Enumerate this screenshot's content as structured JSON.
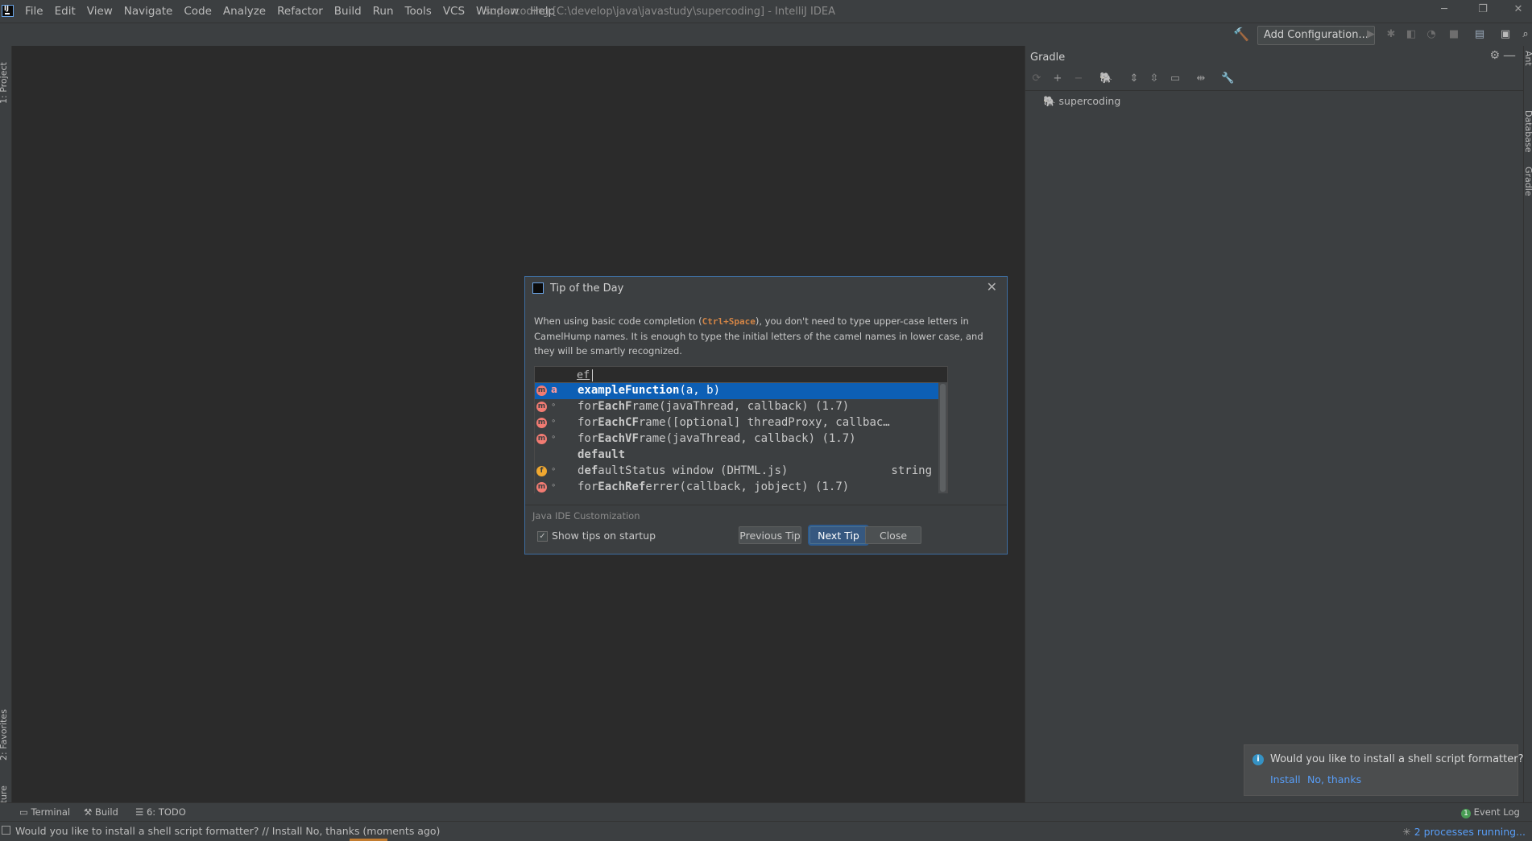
{
  "window": {
    "title": "supercoding [C:\\develop\\java\\javastudy\\supercoding] - IntelliJ IDEA",
    "minimize": "─",
    "restore": "❐",
    "close": "✕"
  },
  "menu": [
    "File",
    "Edit",
    "View",
    "Navigate",
    "Code",
    "Analyze",
    "Refactor",
    "Build",
    "Run",
    "Tools",
    "VCS",
    "Window",
    "Help"
  ],
  "toolbar": {
    "add_configuration": "Add Configuration...",
    "icons": [
      "hammer-icon",
      "run-icon",
      "debug-icon",
      "coverage-icon",
      "profile-icon",
      "stop-icon",
      "project-structure-icon",
      "sdk-icon",
      "search-icon"
    ]
  },
  "left_stripe": {
    "project": "1: Project",
    "favorites": "2: Favorites",
    "structure": "Z: Structure"
  },
  "right_stripe": {
    "ant": "Ant",
    "database": "Database",
    "gradle": "Gradle"
  },
  "gradle": {
    "title": "Gradle",
    "project": "supercoding",
    "tool_icons": [
      "refresh-icon",
      "add-icon",
      "remove-icon",
      "elephant-icon",
      "expand-all-icon",
      "collapse-all-icon",
      "link-icon",
      "offline-icon",
      "wrench-icon"
    ]
  },
  "dialog": {
    "title": "Tip of the Day",
    "tip_part1": "When using basic code completion (",
    "tip_kbd": "Ctrl+Space",
    "tip_part2": "), you don't need to type upper-case letters in CamelHump names. It is enough to type the initial letters of the camel names in lower case, and they will be smartly recognized.",
    "code_input": "ef",
    "completion": [
      {
        "icon": "m",
        "vis": "a",
        "pre": "",
        "hl": "exampleFunction",
        "post": "(a, b)",
        "tail": ""
      },
      {
        "icon": "m",
        "vis": "∘",
        "pre": "for",
        "hl": "EachF",
        "post": "rame(javaThread, callback) (1.7)",
        "tail": ""
      },
      {
        "icon": "m",
        "vis": "∘",
        "pre": "for",
        "hl": "EachCF",
        "post": "rame([optional] threadProxy, callbac…",
        "tail": ""
      },
      {
        "icon": "m",
        "vis": "∘",
        "pre": "for",
        "hl": "EachVF",
        "post": "rame(javaThread, callback) (1.7)",
        "tail": ""
      },
      {
        "icon": "",
        "vis": "",
        "pre": "",
        "hl": "default",
        "post": "",
        "tail": ""
      },
      {
        "icon": "f",
        "vis": "∘",
        "pre": "d",
        "hl": "ef",
        "post": "aultStatus window (DHTML.js)",
        "tail": "string"
      },
      {
        "icon": "m",
        "vis": "∘",
        "pre": "for",
        "hl": "EachRef",
        "post": "errer(callback, jobject) (1.7)",
        "tail": ""
      }
    ],
    "source": "Java IDE Customization",
    "show_tips_label": "Show tips on startup",
    "show_tips_checked": true,
    "previous_tip": "Previous Tip",
    "next_tip": "Next Tip",
    "close": "Close"
  },
  "notification": {
    "text": "Would you like to install a shell script formatter?",
    "install": "Install",
    "no_thanks": "No, thanks"
  },
  "bottom_tabs": {
    "terminal": "Terminal",
    "build": "Build",
    "todo": "6: TODO",
    "event_log": "Event Log",
    "event_count": "1"
  },
  "status": {
    "message": "Would you like to install a shell script formatter? // Install    No, thanks (moments ago)",
    "processes": "2 processes running..."
  }
}
